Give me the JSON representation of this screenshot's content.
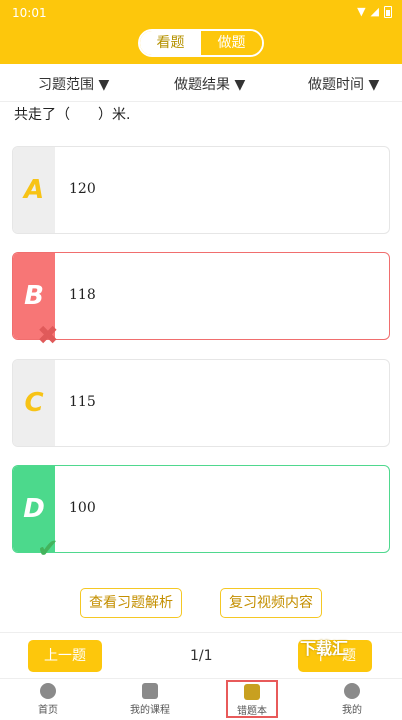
{
  "status": {
    "time": "10:01"
  },
  "header": {
    "tab_view": "看题",
    "tab_do": "做题"
  },
  "filters": {
    "range": "习题范围 ▼",
    "result": "做题结果 ▼",
    "time": "做题时间 ▼"
  },
  "question": {
    "text": "共走了（　　）米."
  },
  "options": [
    {
      "letter": "A",
      "value": "120",
      "state": "normal"
    },
    {
      "letter": "B",
      "value": "118",
      "state": "wrong"
    },
    {
      "letter": "C",
      "value": "115",
      "state": "normal"
    },
    {
      "letter": "D",
      "value": "100",
      "state": "correct"
    }
  ],
  "actions": {
    "analysis": "查看习题解析",
    "video": "复习视频内容"
  },
  "pager": {
    "prev": "上一题",
    "next": "下一题",
    "page": "1/1",
    "watermark": "下载汇"
  },
  "tabs": [
    {
      "label": "首页",
      "icon": "compass-icon"
    },
    {
      "label": "我的课程",
      "icon": "calendar-icon"
    },
    {
      "label": "错题本",
      "icon": "notebook-icon"
    },
    {
      "label": "我的",
      "icon": "profile-icon"
    }
  ],
  "colors": {
    "brand": "#fdc70c",
    "wrong": "#f77676",
    "correct": "#4cd98c"
  }
}
